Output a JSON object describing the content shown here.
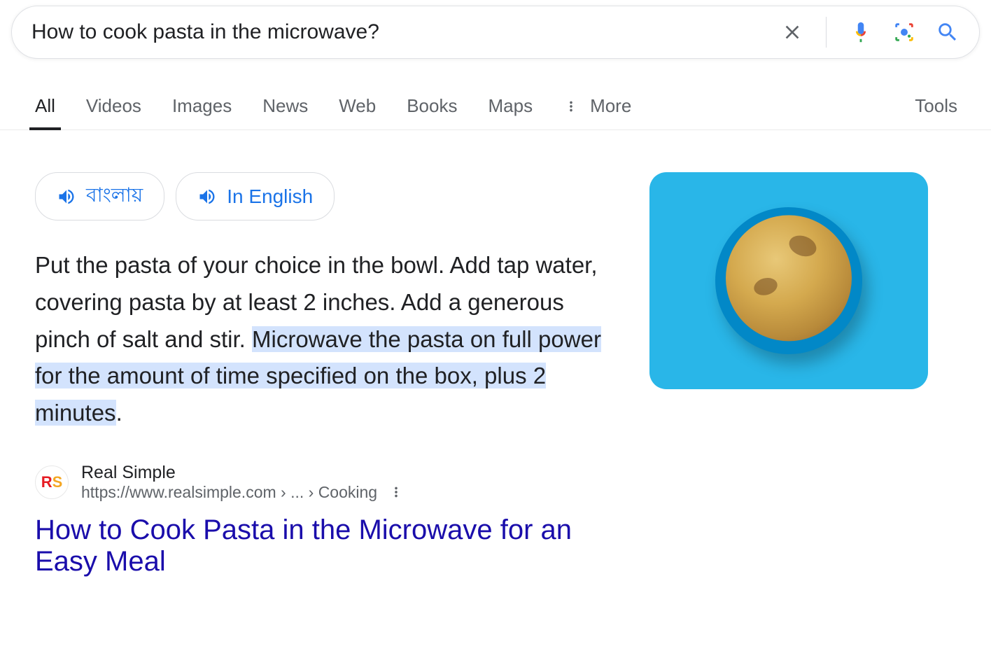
{
  "search": {
    "query": "How to cook pasta in the microwave?"
  },
  "tabs": {
    "items": [
      {
        "label": "All",
        "active": true
      },
      {
        "label": "Videos",
        "active": false
      },
      {
        "label": "Images",
        "active": false
      },
      {
        "label": "News",
        "active": false
      },
      {
        "label": "Web",
        "active": false
      },
      {
        "label": "Books",
        "active": false
      },
      {
        "label": "Maps",
        "active": false
      }
    ],
    "more": "More",
    "tools": "Tools"
  },
  "lang_chips": [
    {
      "label": "বাংলায়"
    },
    {
      "label": "In English"
    }
  ],
  "snippet": {
    "prefix": "Put the pasta of your choice in the bowl. Add tap water, covering pasta by at least 2 inches. Add a generous pinch of salt and stir. ",
    "highlight": "Microwave the pasta on full power for the amount of time specified on the box, plus 2 minutes",
    "suffix": "."
  },
  "result": {
    "favicon_text_r": "R",
    "favicon_text_s": "S",
    "site_name": "Real Simple",
    "url_display": "https://www.realsimple.com › ... › Cooking",
    "title": "How to Cook Pasta in the Microwave for an Easy Meal"
  },
  "icons": {
    "clear": "clear-icon",
    "mic": "mic-icon",
    "lens": "lens-icon",
    "search": "search-icon",
    "more_vert": "more-vert-icon",
    "speaker": "speaker-icon"
  }
}
